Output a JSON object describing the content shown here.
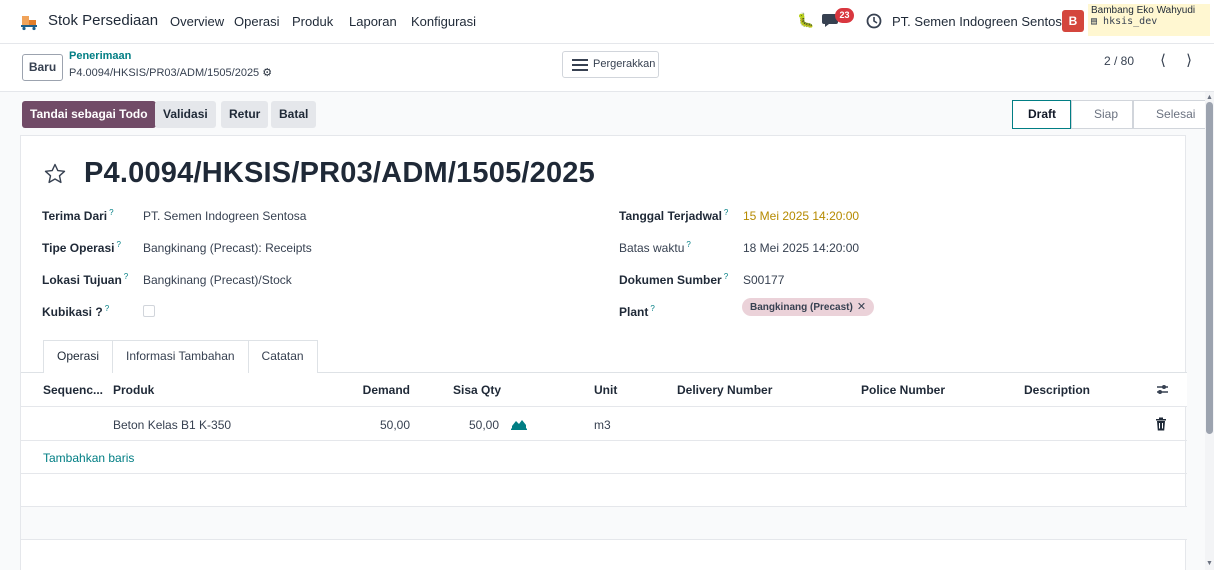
{
  "nav": {
    "app_title": "Stok Persediaan",
    "items": [
      "Overview",
      "Operasi",
      "Produk",
      "Laporan",
      "Konfigurasi"
    ],
    "chat_count": "23",
    "company": "PT. Semen Indogreen Sentosa",
    "avatar_letter": "B",
    "user_name": "Bambang Eko Wahyudi",
    "user_db": "hksis_dev"
  },
  "control": {
    "new_label": "Baru",
    "breadcrumb_parent": "Penerimaan",
    "breadcrumb_current": "P4.0094/HKSIS/PR03/ADM/1505/2025",
    "moves_label": "Pergerakkan",
    "pager": "2 / 80"
  },
  "actions": {
    "mark_todo": "Tandai sebagai Todo",
    "validate": "Validasi",
    "return": "Retur",
    "cancel": "Batal"
  },
  "stages": [
    "Draft",
    "Siap",
    "Selesai"
  ],
  "record": {
    "title": "P4.0094/HKSIS/PR03/ADM/1505/2025",
    "left_fields": [
      {
        "label": "Terima Dari",
        "value": "PT. Semen Indogreen Sentosa"
      },
      {
        "label": "Tipe Operasi",
        "value": "Bangkinang (Precast): Receipts"
      },
      {
        "label": "Lokasi Tujuan",
        "value": "Bangkinang (Precast)/Stock"
      },
      {
        "label": "Kubikasi ?",
        "value": ""
      }
    ],
    "right_fields": [
      {
        "label": "Tanggal Terjadwal",
        "value": "15 Mei 2025 14:20:00"
      },
      {
        "label": "Batas waktu",
        "value": "18 Mei 2025 14:20:00"
      },
      {
        "label": "Dokumen Sumber",
        "value": "S00177"
      },
      {
        "label": "Plant",
        "value": "Bangkinang (Precast)"
      }
    ],
    "help_mark": "?"
  },
  "tabs": [
    "Operasi",
    "Informasi Tambahan",
    "Catatan"
  ],
  "table": {
    "headers": [
      "Sequenc...",
      "Produk",
      "Demand",
      "Sisa Qty",
      "Unit",
      "Delivery Number",
      "Police Number",
      "Description"
    ],
    "rows": [
      {
        "sequence": "",
        "product": "Beton Kelas B1 K-350",
        "demand": "50,00",
        "remaining": "50,00",
        "unit": "m3",
        "delivery": "",
        "police": "",
        "description": ""
      }
    ],
    "add_line": "Tambahkan baris"
  },
  "colors": {
    "primary": "#714b67",
    "link": "#017e84",
    "badge": "#d9373f",
    "tag_bg": "#ebd2d9",
    "warning_date": "#b58a00"
  }
}
